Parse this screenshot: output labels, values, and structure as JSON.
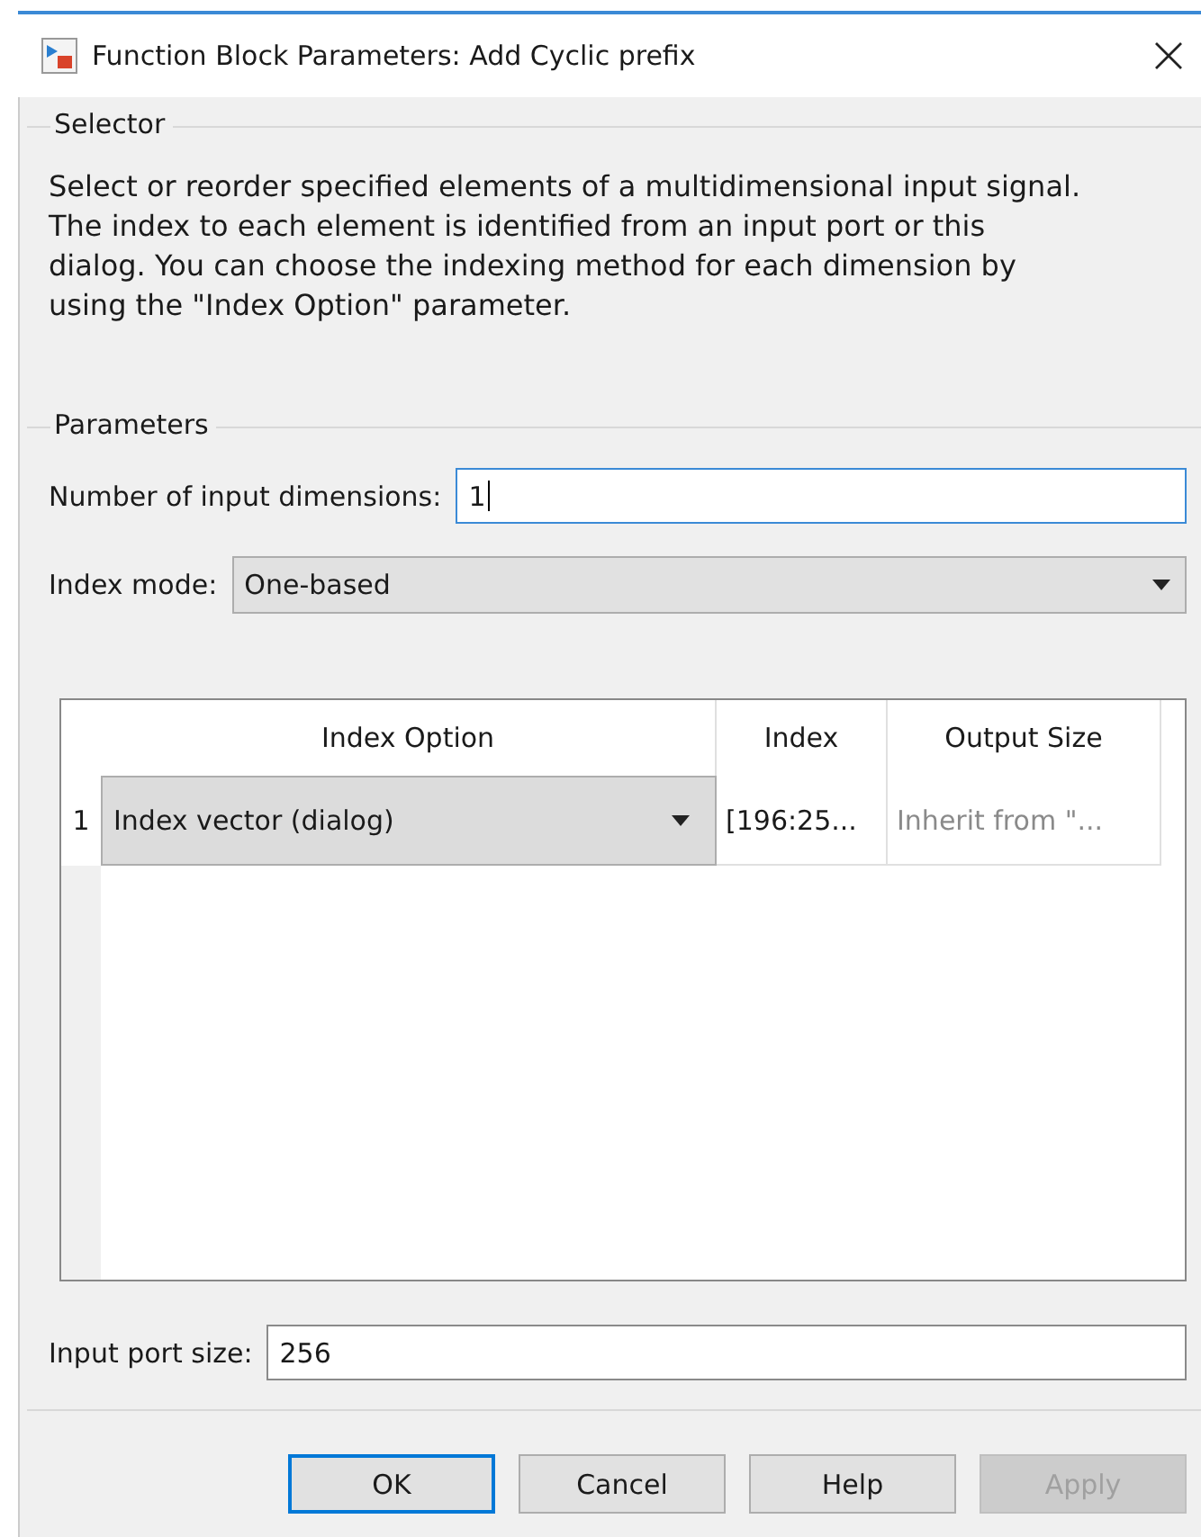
{
  "window": {
    "title": "Function Block Parameters: Add Cyclic prefix"
  },
  "selector": {
    "legend": "Selector",
    "description": "Select or reorder specified elements of a multidimensional input signal. The index to each element is identified from an input port or this dialog. You can choose the indexing method for each dimension by using the \"Index Option\" parameter."
  },
  "parameters": {
    "legend": "Parameters",
    "fields": [
      {
        "kind": "text",
        "label": "Number of input dimensions:",
        "value": "1",
        "focused": true
      },
      {
        "kind": "dropdown",
        "label": "Index mode:",
        "value": "One-based"
      }
    ],
    "table": {
      "columns": [
        "Index Option",
        "Index",
        "Output Size"
      ],
      "rows": [
        {
          "number": "1",
          "index_option": "Index vector (dialog)",
          "index": "[196:25...",
          "output_size": "Inherit from \"...",
          "output_size_disabled": true
        }
      ]
    },
    "port_size": {
      "label": "Input port size:",
      "value": "256",
      "focused": false
    }
  },
  "buttons": [
    {
      "label": "OK",
      "default": true,
      "disabled": false
    },
    {
      "label": "Cancel",
      "default": false,
      "disabled": false
    },
    {
      "label": "Help",
      "default": false,
      "disabled": false
    },
    {
      "label": "Apply",
      "default": false,
      "disabled": true
    }
  ]
}
